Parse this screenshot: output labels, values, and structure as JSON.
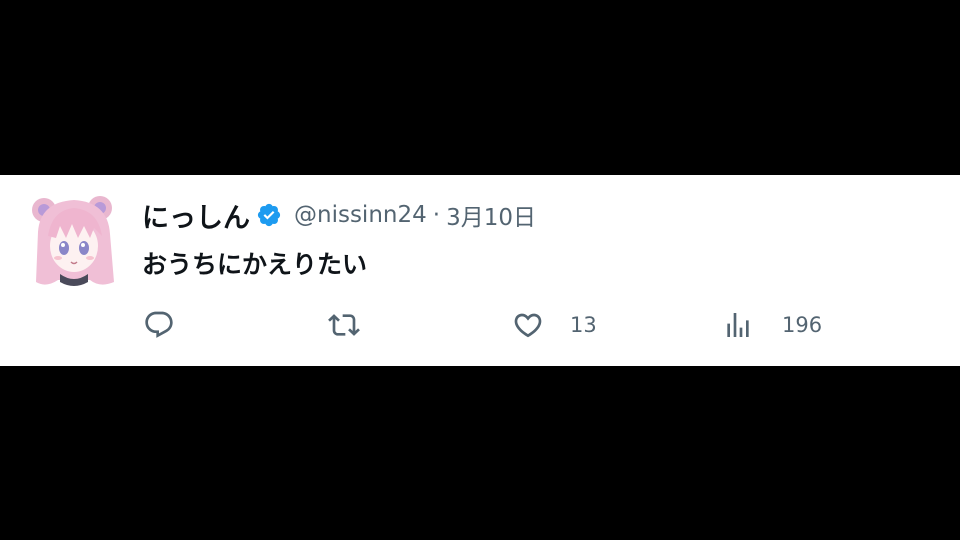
{
  "tweet": {
    "display_name": "にっしん",
    "handle": "@nissinn24",
    "separator": "·",
    "date": "3月10日",
    "text": "おうちにかえりたい",
    "avatar_icon": "anime-girl-avatar",
    "verified_icon": "verified-badge-icon"
  },
  "actions": {
    "reply": {
      "icon": "reply-icon",
      "count": ""
    },
    "retweet": {
      "icon": "retweet-icon",
      "count": ""
    },
    "like": {
      "icon": "heart-icon",
      "count": "13"
    },
    "views": {
      "icon": "views-bar-chart-icon",
      "count": "196"
    }
  },
  "colors": {
    "text_primary": "#0f1419",
    "text_secondary": "#536471",
    "verified_blue": "#1d9bf0",
    "background": "#ffffff",
    "letterbox": "#000000"
  }
}
